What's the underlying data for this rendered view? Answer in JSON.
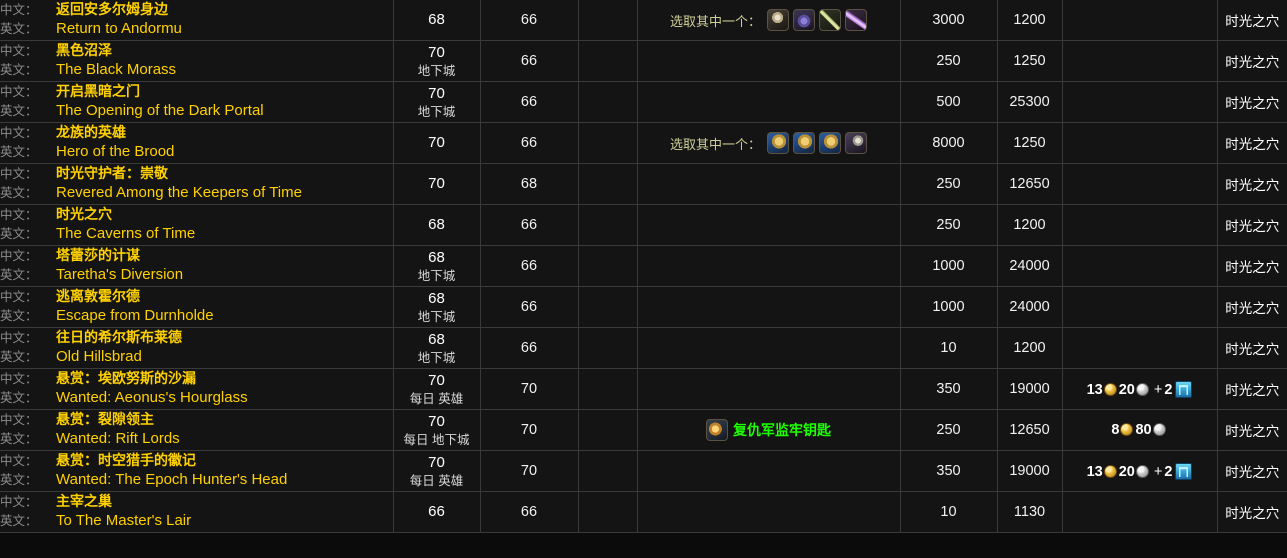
{
  "labels": {
    "zh_label": "中文：",
    "en_label": "英文：",
    "choose_one": "选取其中一个：",
    "dungeon": "地下城",
    "daily": "每日",
    "heroic": "英雄"
  },
  "colors": {
    "quest_title": "#ffd100",
    "lang_label": "#8c8c8c",
    "item_green": "#1eff00",
    "grid_border": "#3a3a3a",
    "row_bg": "#141414",
    "gold": "#f0c040",
    "silver": "#cfcfcf",
    "token": "#3ba8d8"
  },
  "rows": [
    {
      "zh": "返回安多尔姆身边",
      "en": "Return to Andormu",
      "level": "68",
      "level_sub": "",
      "req_level": "66",
      "side": "",
      "choose_label": "选取其中一个：",
      "choice_icons": [
        "mace-item-icon",
        "gem-item-icon",
        "bow-item-icon",
        "dagger-item-icon"
      ],
      "item_reward": "",
      "rep": "3000",
      "xp": "1200",
      "money": {
        "gold": "",
        "silver": "",
        "token": ""
      },
      "zone": "时光之穴"
    },
    {
      "zh": "黑色沼泽",
      "en": "The Black Morass",
      "level": "70",
      "level_sub": "地下城",
      "req_level": "66",
      "side": "",
      "choose_label": "",
      "choice_icons": [],
      "item_reward": "",
      "rep": "250",
      "xp": "1250",
      "money": {
        "gold": "",
        "silver": "",
        "token": ""
      },
      "zone": "时光之穴"
    },
    {
      "zh": "开启黑暗之门",
      "en": "The Opening of the Dark Portal",
      "level": "70",
      "level_sub": "地下城",
      "req_level": "66",
      "side": "",
      "choose_label": "",
      "choice_icons": [],
      "item_reward": "",
      "rep": "500",
      "xp": "25300",
      "money": {
        "gold": "",
        "silver": "",
        "token": ""
      },
      "zone": "时光之穴"
    },
    {
      "zh": "龙族的英雄",
      "en": "Hero of the Brood",
      "level": "70",
      "level_sub": "",
      "req_level": "66",
      "side": "",
      "choose_label": "选取其中一个：",
      "choice_icons": [
        "shoulder-item-icon",
        "shoulder-item-icon",
        "shoulder-item-icon",
        "cloak-item-icon"
      ],
      "item_reward": "",
      "rep": "8000",
      "xp": "1250",
      "money": {
        "gold": "",
        "silver": "",
        "token": ""
      },
      "zone": "时光之穴"
    },
    {
      "zh": "时光守护者：崇敬",
      "en": "Revered Among the Keepers of Time",
      "level": "70",
      "level_sub": "",
      "req_level": "68",
      "side": "",
      "choose_label": "",
      "choice_icons": [],
      "item_reward": "",
      "rep": "250",
      "xp": "12650",
      "money": {
        "gold": "",
        "silver": "",
        "token": ""
      },
      "zone": "时光之穴"
    },
    {
      "zh": "时光之穴",
      "en": "The Caverns of Time",
      "level": "68",
      "level_sub": "",
      "req_level": "66",
      "side": "",
      "choose_label": "",
      "choice_icons": [],
      "item_reward": "",
      "rep": "250",
      "xp": "1200",
      "money": {
        "gold": "",
        "silver": "",
        "token": ""
      },
      "zone": "时光之穴"
    },
    {
      "zh": "塔蕾莎的计谋",
      "en": "Taretha's Diversion",
      "level": "68",
      "level_sub": "地下城",
      "req_level": "66",
      "side": "",
      "choose_label": "",
      "choice_icons": [],
      "item_reward": "",
      "rep": "1000",
      "xp": "24000",
      "money": {
        "gold": "",
        "silver": "",
        "token": ""
      },
      "zone": "时光之穴"
    },
    {
      "zh": "逃离敦霍尔德",
      "en": "Escape from Durnholde",
      "level": "68",
      "level_sub": "地下城",
      "req_level": "66",
      "side": "",
      "choose_label": "",
      "choice_icons": [],
      "item_reward": "",
      "rep": "1000",
      "xp": "24000",
      "money": {
        "gold": "",
        "silver": "",
        "token": ""
      },
      "zone": "时光之穴"
    },
    {
      "zh": "往日的希尔斯布莱德",
      "en": "Old Hillsbrad",
      "level": "68",
      "level_sub": "地下城",
      "req_level": "66",
      "side": "",
      "choose_label": "",
      "choice_icons": [],
      "item_reward": "",
      "rep": "10",
      "xp": "1200",
      "money": {
        "gold": "",
        "silver": "",
        "token": ""
      },
      "zone": "时光之穴"
    },
    {
      "zh": "悬赏：埃欧努斯的沙漏",
      "en": "Wanted: Aeonus's Hourglass",
      "level": "70",
      "level_sub": "每日 英雄",
      "req_level": "70",
      "side": "",
      "choose_label": "",
      "choice_icons": [],
      "item_reward": "",
      "rep": "350",
      "xp": "19000",
      "money": {
        "gold": "13",
        "silver": "20",
        "token": "2"
      },
      "zone": "时光之穴"
    },
    {
      "zh": "悬赏：裂隙领主",
      "en": "Wanted: Rift Lords",
      "level": "70",
      "level_sub": "每日 地下城",
      "req_level": "70",
      "side": "",
      "choose_label": "",
      "choice_icons": [],
      "item_reward": "复仇军监牢钥匙",
      "item_icon": "key-item-icon",
      "rep": "250",
      "xp": "12650",
      "money": {
        "gold": "8",
        "silver": "80",
        "token": ""
      },
      "zone": "时光之穴"
    },
    {
      "zh": "悬赏：时空猎手的徽记",
      "en": "Wanted: The Epoch Hunter's Head",
      "level": "70",
      "level_sub": "每日 英雄",
      "req_level": "70",
      "side": "",
      "choose_label": "",
      "choice_icons": [],
      "item_reward": "",
      "rep": "350",
      "xp": "19000",
      "money": {
        "gold": "13",
        "silver": "20",
        "token": "2"
      },
      "zone": "时光之穴"
    },
    {
      "zh": "主宰之巢",
      "en": "To The Master's Lair",
      "level": "66",
      "level_sub": "",
      "req_level": "66",
      "side": "",
      "choose_label": "",
      "choice_icons": [],
      "item_reward": "",
      "rep": "10",
      "xp": "1130",
      "money": {
        "gold": "",
        "silver": "",
        "token": ""
      },
      "zone": "时光之穴"
    }
  ]
}
